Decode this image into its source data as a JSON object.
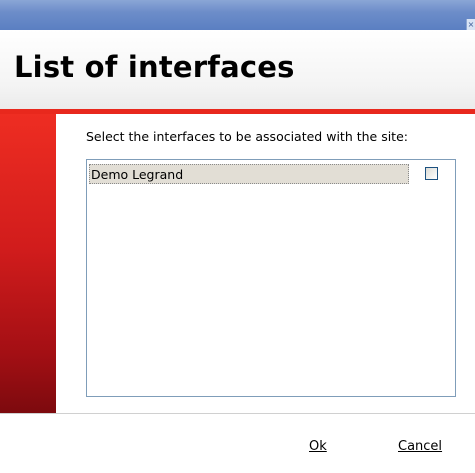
{
  "dialog": {
    "title": "List of interfaces",
    "instruction": "Select the interfaces to be associated with the site:"
  },
  "titlebar": {
    "close_glyph": "×"
  },
  "interfaces": [
    {
      "name": "Demo Legrand",
      "checked": false
    }
  ],
  "buttons": {
    "ok": "Ok",
    "cancel": "Cancel"
  },
  "colors": {
    "accent_red": "#e8281d",
    "titlebar_blue": "#6d8dc9"
  }
}
